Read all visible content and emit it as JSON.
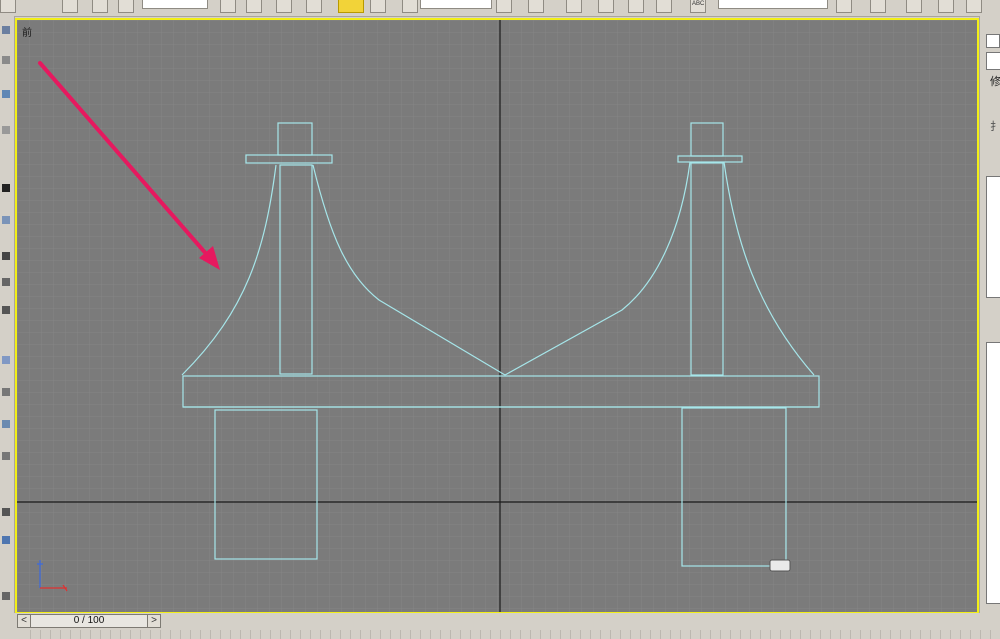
{
  "viewport": {
    "label": "前",
    "background": "#7b7b7b",
    "border_color": "#f2ef17",
    "wire_color": "#a6e6ea",
    "arrow_color": "#e6195f"
  },
  "right_panel": {
    "tab_text": "修",
    "field_text": "扌"
  },
  "toolbar": {
    "snap_text": "ABC"
  },
  "timeline": {
    "frame_label": "0 / 100",
    "prev_label": "<",
    "next_label": ">"
  }
}
